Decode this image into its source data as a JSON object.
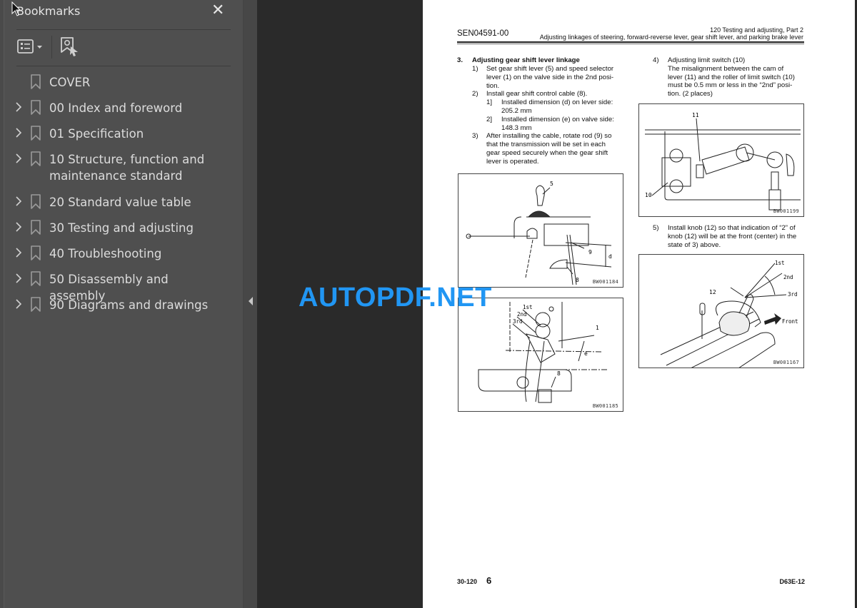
{
  "sidebar": {
    "title": "Bookmarks",
    "close_label": "✕",
    "tools": {
      "options_icon": "list-options-icon",
      "add_bookmark_icon": "add-bookmark-icon"
    },
    "items": [
      {
        "label": "COVER",
        "expandable": false
      },
      {
        "label": "00 Index and foreword",
        "expandable": true
      },
      {
        "label": "01 Specification",
        "expandable": true
      },
      {
        "label": "10 Structure, function and maintenance standard",
        "expandable": true
      },
      {
        "label": "20 Standard value table",
        "expandable": true
      },
      {
        "label": "30 Testing and adjusting",
        "expandable": true
      },
      {
        "label": "40 Troubleshooting",
        "expandable": true
      },
      {
        "label": "50 Disassembly and assembly",
        "expandable": true
      },
      {
        "label": "90 Diagrams and drawings",
        "expandable": true
      }
    ]
  },
  "page": {
    "header": {
      "doc_id": "SEN04591-00",
      "section": "120 Testing and adjusting, Part 2",
      "subtitle": "Adjusting linkages of steering, forward-reverse lever, gear shift lever, and parking brake lever"
    },
    "left_col": {
      "heading_num": "3.",
      "heading": "Adjusting gear shift lever linkage",
      "steps": [
        {
          "num": "1)",
          "lines": [
            "Set gear shift lever (5) and speed selector",
            "lever (1) on the valve side in the 2nd posi-",
            "tion."
          ]
        },
        {
          "num": "2)",
          "lines": [
            "Install gear shift control cable (8)."
          ]
        },
        {
          "num": "1]",
          "lines": [
            "Installed dimension (d) on lever side:",
            "205.2 mm"
          ]
        },
        {
          "num": "2]",
          "lines": [
            "Installed dimension (e) on valve side:",
            "148.3 mm"
          ]
        },
        {
          "num": "3)",
          "lines": [
            "After installing the cable, rotate rod (9) so",
            "that the transmission will be set in each",
            "gear speed securely when the gear shift",
            "lever is operated."
          ]
        }
      ]
    },
    "right_col": {
      "steps": [
        {
          "num": "4)",
          "lines": [
            "Adjusting limit switch (10)",
            "The misalignment between the cam of",
            "lever (11) and the roller of limit switch (10)",
            "must be 0.5 mm or less in the “2nd” posi-",
            "tion. (2 places)"
          ]
        },
        {
          "num": "5)",
          "lines": [
            "Install knob (12) so that indication of “2” of",
            "knob (12) will be at the front (center) in the",
            "state of 3) above."
          ]
        }
      ]
    },
    "figures": [
      {
        "code": "BW001184",
        "labels": [
          "5",
          "9",
          "d",
          "8"
        ]
      },
      {
        "code": "BW001185",
        "labels": [
          "1st",
          "2nd",
          "3rd",
          "1",
          "e",
          "8"
        ]
      },
      {
        "code": "BW001199",
        "labels": [
          "11",
          "10"
        ]
      },
      {
        "code": "BW001167",
        "labels": [
          "1st",
          "2nd",
          "3rd",
          "12",
          "Front"
        ]
      }
    ],
    "footer": {
      "page_ref": "30-120",
      "page_num": "6",
      "model": "D63E-12"
    }
  },
  "watermark": "AUTOPDF.NET",
  "colors": {
    "watermark": "#2196f3",
    "sidebar_bg": "#4f4f4f",
    "viewer_bg": "#2a2a2a"
  }
}
